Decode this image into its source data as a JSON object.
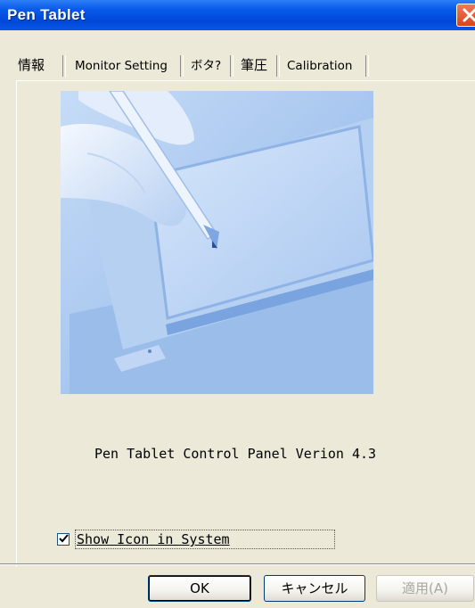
{
  "window": {
    "title": "Pen Tablet"
  },
  "tabs": [
    {
      "label": "情報"
    },
    {
      "label": "Monitor Setting"
    },
    {
      "label": "ボタ?"
    },
    {
      "label": "筆圧"
    },
    {
      "label": "Calibration"
    }
  ],
  "info": {
    "version_text": "Pen Tablet Control Panel Verion 4.3",
    "show_icon_label": "Show Icon in System",
    "show_icon_checked": true
  },
  "buttons": {
    "ok": "OK",
    "cancel": "キャンセル",
    "apply": "適用(A)"
  },
  "colors": {
    "titlebar": "#0a5bea",
    "dialog_bg": "#ece9d8",
    "illustration": "#a9c8f0"
  }
}
